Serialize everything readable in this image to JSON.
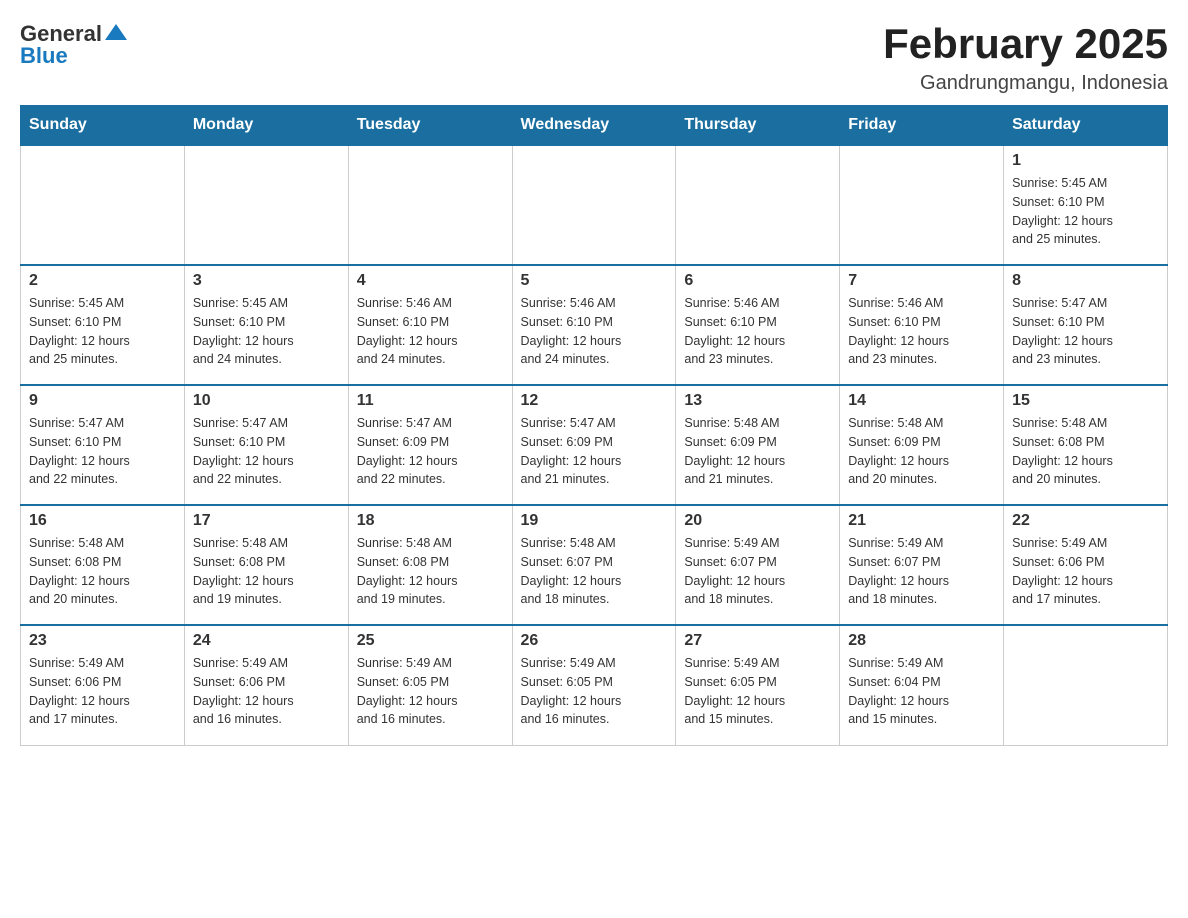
{
  "header": {
    "logo_general": "General",
    "logo_arrow": "▲",
    "logo_blue": "Blue",
    "title": "February 2025",
    "location": "Gandrungmangu, Indonesia"
  },
  "days_of_week": [
    "Sunday",
    "Monday",
    "Tuesday",
    "Wednesday",
    "Thursday",
    "Friday",
    "Saturday"
  ],
  "weeks": [
    {
      "days": [
        {
          "date": "",
          "info": ""
        },
        {
          "date": "",
          "info": ""
        },
        {
          "date": "",
          "info": ""
        },
        {
          "date": "",
          "info": ""
        },
        {
          "date": "",
          "info": ""
        },
        {
          "date": "",
          "info": ""
        },
        {
          "date": "1",
          "info": "Sunrise: 5:45 AM\nSunset: 6:10 PM\nDaylight: 12 hours\nand 25 minutes."
        }
      ]
    },
    {
      "days": [
        {
          "date": "2",
          "info": "Sunrise: 5:45 AM\nSunset: 6:10 PM\nDaylight: 12 hours\nand 25 minutes."
        },
        {
          "date": "3",
          "info": "Sunrise: 5:45 AM\nSunset: 6:10 PM\nDaylight: 12 hours\nand 24 minutes."
        },
        {
          "date": "4",
          "info": "Sunrise: 5:46 AM\nSunset: 6:10 PM\nDaylight: 12 hours\nand 24 minutes."
        },
        {
          "date": "5",
          "info": "Sunrise: 5:46 AM\nSunset: 6:10 PM\nDaylight: 12 hours\nand 24 minutes."
        },
        {
          "date": "6",
          "info": "Sunrise: 5:46 AM\nSunset: 6:10 PM\nDaylight: 12 hours\nand 23 minutes."
        },
        {
          "date": "7",
          "info": "Sunrise: 5:46 AM\nSunset: 6:10 PM\nDaylight: 12 hours\nand 23 minutes."
        },
        {
          "date": "8",
          "info": "Sunrise: 5:47 AM\nSunset: 6:10 PM\nDaylight: 12 hours\nand 23 minutes."
        }
      ]
    },
    {
      "days": [
        {
          "date": "9",
          "info": "Sunrise: 5:47 AM\nSunset: 6:10 PM\nDaylight: 12 hours\nand 22 minutes."
        },
        {
          "date": "10",
          "info": "Sunrise: 5:47 AM\nSunset: 6:10 PM\nDaylight: 12 hours\nand 22 minutes."
        },
        {
          "date": "11",
          "info": "Sunrise: 5:47 AM\nSunset: 6:09 PM\nDaylight: 12 hours\nand 22 minutes."
        },
        {
          "date": "12",
          "info": "Sunrise: 5:47 AM\nSunset: 6:09 PM\nDaylight: 12 hours\nand 21 minutes."
        },
        {
          "date": "13",
          "info": "Sunrise: 5:48 AM\nSunset: 6:09 PM\nDaylight: 12 hours\nand 21 minutes."
        },
        {
          "date": "14",
          "info": "Sunrise: 5:48 AM\nSunset: 6:09 PM\nDaylight: 12 hours\nand 20 minutes."
        },
        {
          "date": "15",
          "info": "Sunrise: 5:48 AM\nSunset: 6:08 PM\nDaylight: 12 hours\nand 20 minutes."
        }
      ]
    },
    {
      "days": [
        {
          "date": "16",
          "info": "Sunrise: 5:48 AM\nSunset: 6:08 PM\nDaylight: 12 hours\nand 20 minutes."
        },
        {
          "date": "17",
          "info": "Sunrise: 5:48 AM\nSunset: 6:08 PM\nDaylight: 12 hours\nand 19 minutes."
        },
        {
          "date": "18",
          "info": "Sunrise: 5:48 AM\nSunset: 6:08 PM\nDaylight: 12 hours\nand 19 minutes."
        },
        {
          "date": "19",
          "info": "Sunrise: 5:48 AM\nSunset: 6:07 PM\nDaylight: 12 hours\nand 18 minutes."
        },
        {
          "date": "20",
          "info": "Sunrise: 5:49 AM\nSunset: 6:07 PM\nDaylight: 12 hours\nand 18 minutes."
        },
        {
          "date": "21",
          "info": "Sunrise: 5:49 AM\nSunset: 6:07 PM\nDaylight: 12 hours\nand 18 minutes."
        },
        {
          "date": "22",
          "info": "Sunrise: 5:49 AM\nSunset: 6:06 PM\nDaylight: 12 hours\nand 17 minutes."
        }
      ]
    },
    {
      "days": [
        {
          "date": "23",
          "info": "Sunrise: 5:49 AM\nSunset: 6:06 PM\nDaylight: 12 hours\nand 17 minutes."
        },
        {
          "date": "24",
          "info": "Sunrise: 5:49 AM\nSunset: 6:06 PM\nDaylight: 12 hours\nand 16 minutes."
        },
        {
          "date": "25",
          "info": "Sunrise: 5:49 AM\nSunset: 6:05 PM\nDaylight: 12 hours\nand 16 minutes."
        },
        {
          "date": "26",
          "info": "Sunrise: 5:49 AM\nSunset: 6:05 PM\nDaylight: 12 hours\nand 16 minutes."
        },
        {
          "date": "27",
          "info": "Sunrise: 5:49 AM\nSunset: 6:05 PM\nDaylight: 12 hours\nand 15 minutes."
        },
        {
          "date": "28",
          "info": "Sunrise: 5:49 AM\nSunset: 6:04 PM\nDaylight: 12 hours\nand 15 minutes."
        },
        {
          "date": "",
          "info": ""
        }
      ]
    }
  ]
}
